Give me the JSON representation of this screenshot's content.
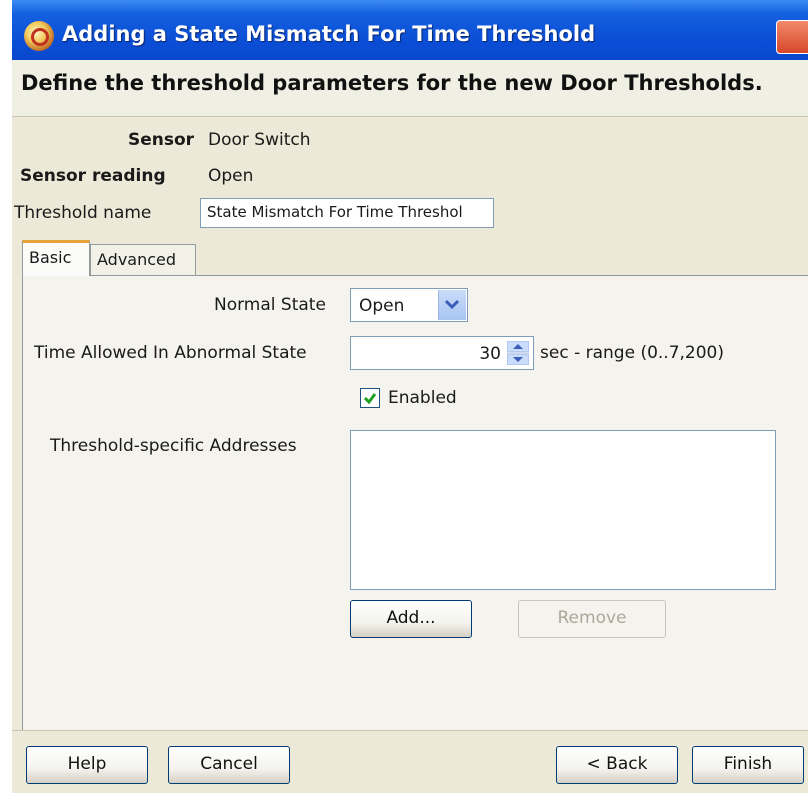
{
  "title": "Adding a State Mismatch For Time Threshold",
  "heading": "Define the threshold parameters for the new Door Thresholds.",
  "sensor": {
    "label": "Sensor",
    "value": "Door Switch"
  },
  "sensor_reading": {
    "label": "Sensor reading",
    "value": "Open"
  },
  "threshold_name": {
    "label": "Threshold name",
    "value": "State Mismatch For Time Threshol"
  },
  "tabs": {
    "basic": "Basic",
    "advanced": "Advanced"
  },
  "normal_state": {
    "label": "Normal State",
    "value": "Open"
  },
  "time_allowed": {
    "label": "Time Allowed In Abnormal State",
    "value": "30",
    "suffix": "sec - range (0..7,200)"
  },
  "enabled": {
    "label": "Enabled",
    "checked": true
  },
  "addresses": {
    "label": "Threshold-specific Addresses",
    "add": "Add...",
    "remove": "Remove"
  },
  "footer": {
    "help": "Help",
    "cancel": "Cancel",
    "back": "< Back",
    "finish": "Finish"
  }
}
